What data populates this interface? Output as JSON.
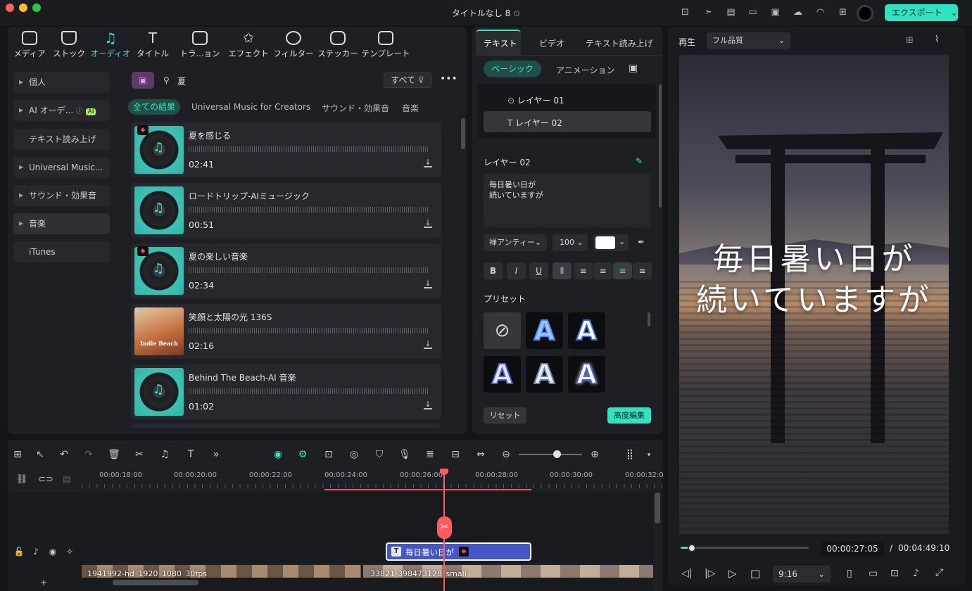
{
  "window": {
    "title": "タイトルなし 8",
    "export_label": "エクスポート"
  },
  "media_tabs": [
    {
      "label": "メディア",
      "name": "tab-media"
    },
    {
      "label": "ストック",
      "name": "tab-stock"
    },
    {
      "label": "オーディオ",
      "name": "tab-audio"
    },
    {
      "label": "タイトル",
      "name": "tab-title"
    },
    {
      "label": "トラ...ョン",
      "name": "tab-transition"
    },
    {
      "label": "エフェクト",
      "name": "tab-effect"
    },
    {
      "label": "フィルター",
      "name": "tab-filter"
    },
    {
      "label": "ステッカー",
      "name": "tab-sticker"
    },
    {
      "label": "テンプレート",
      "name": "tab-template"
    }
  ],
  "sidebar": [
    {
      "label": "個人"
    },
    {
      "label": "AI オーデ..."
    },
    {
      "label": "テキスト読み上げ"
    },
    {
      "label": "Universal Music..."
    },
    {
      "label": "サウンド・効果音"
    },
    {
      "label": "音楽"
    },
    {
      "label": "iTunes"
    }
  ],
  "ai_badge": "AI",
  "search": {
    "query": "夏",
    "filter_label": "すべて"
  },
  "categories": [
    "全ての結果",
    "Universal Music for Creators",
    "サウンド・効果音",
    "音楽"
  ],
  "tracks": [
    {
      "title": "夏を感じる",
      "duration": "02:41"
    },
    {
      "title": "ロードトリップ-AIミュージック",
      "duration": "00:51"
    },
    {
      "title": "夏の楽しい音楽",
      "duration": "02:34"
    },
    {
      "title": "笑顔と太陽の光 136S",
      "duration": "02:16",
      "thumb_text": "Indie Beach"
    },
    {
      "title": "Behind The Beach-AI 音楽",
      "duration": "01:02"
    }
  ],
  "props": {
    "tabs": [
      "テキスト",
      "ビデオ",
      "テキスト読み上げ"
    ],
    "subtabs": [
      "ベーシック",
      "アニメーション"
    ],
    "layers": [
      "レイヤー 01",
      "レイヤー 02"
    ],
    "section_title": "レイヤー 02",
    "text_line1": "毎日暑い日が",
    "text_line2": "続いていますが",
    "font": "禅アンティー",
    "size": "100",
    "preset_label": "プリセット",
    "reset_label": "リセット",
    "advanced_label": "高度編集"
  },
  "preview": {
    "play_label": "再生",
    "quality": "フル品質",
    "caption_line1": "毎日暑い日が",
    "caption_line2": "続いていますが",
    "current_time": "00:00:27:05",
    "separator": "/",
    "total_time": "00:04:49:10",
    "ratio": "9:16",
    "progress": 0.09
  },
  "timeline": {
    "ticks": [
      "00:00:18:00",
      "00:00:20:00",
      "00:00:22:00",
      "00:00:24:00",
      "00:00:26:00",
      "00:00:28:00",
      "00:00:30:00",
      "00:00:32:0"
    ],
    "clip_text": "毎日暑い日が",
    "video1": "1941992-hd_1920_1080_30fps",
    "video2": "33821-398473128_small"
  }
}
